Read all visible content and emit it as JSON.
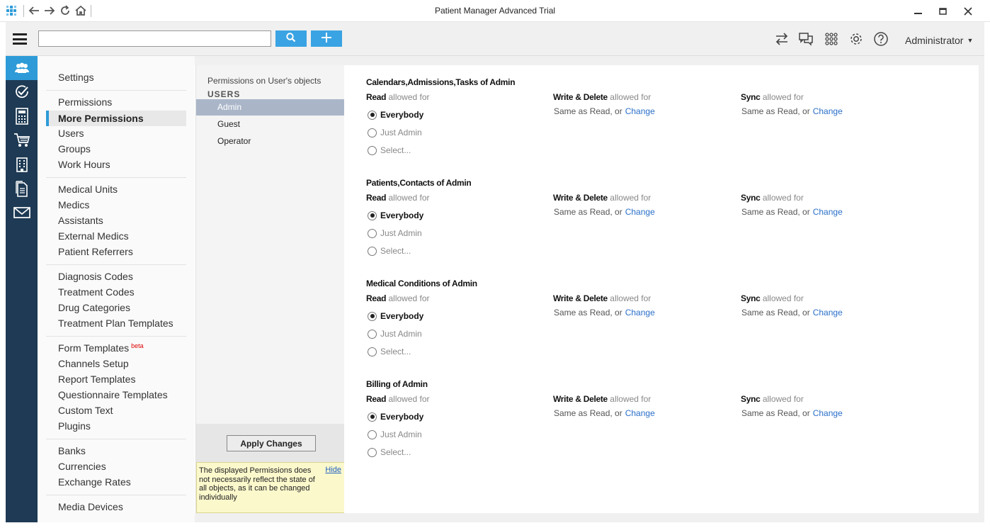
{
  "window": {
    "title": "Patient Manager Advanced Trial",
    "nav_icons": [
      "back-arrow-icon",
      "forward-arrow-icon",
      "refresh-icon",
      "home-icon"
    ],
    "controls": [
      "minimize-icon",
      "maximize-icon",
      "close-icon"
    ]
  },
  "toolbar": {
    "search_value": "",
    "search_icon": "search-icon",
    "add_icon": "plus-icon",
    "right_icons": [
      "sync-arrows-icon",
      "chat-icon",
      "apps-grid-icon",
      "gear-icon",
      "help-icon"
    ],
    "user_label": "Administrator",
    "accent": "#3aa3e3"
  },
  "rail": {
    "items": [
      "users-icon",
      "checkmark-icon",
      "calculator-icon",
      "cart-icon",
      "building-icon",
      "document-icon",
      "mail-icon"
    ],
    "active_index": 0,
    "bg": "#1e3a54",
    "active_bg": "#2e9bd8"
  },
  "settings": {
    "groups": [
      [
        "Settings"
      ],
      [
        "Permissions",
        "More Permissions",
        "Users",
        "Groups",
        "Work Hours"
      ],
      [
        "Medical Units",
        "Medics",
        "Assistants",
        "External Medics",
        "Patient Referrers"
      ],
      [
        "Diagnosis Codes",
        "Treatment Codes",
        "Drug Categories",
        "Treatment Plan Templates"
      ],
      [
        "Form Templates",
        "Channels Setup",
        "Report Templates",
        "Questionnaire Templates",
        "Custom Text",
        "Plugins"
      ],
      [
        "Banks",
        "Currencies",
        "Exchange Rates"
      ],
      [
        "Media Devices"
      ]
    ],
    "active": "More Permissions",
    "beta_label": "beta"
  },
  "users_panel": {
    "heading": "Permissions on User's objects",
    "users_label": "USERS",
    "users": [
      "Admin",
      "Guest",
      "Operator"
    ],
    "active_user": "Admin",
    "apply_label": "Apply Changes",
    "note_text": "The displayed Permissions  does not necessarily reflect the state of all objects, as it can be changed individually",
    "hide_label": "Hide"
  },
  "sections": [
    {
      "title": "Calendars,Admissions,Tasks of Admin",
      "read_label": "Read",
      "read_suffix": " allowed for",
      "write_label": "Write & Delete",
      "write_suffix": " allowed for",
      "sync_label": "Sync",
      "sync_suffix": " allowed for",
      "same_as": "Same as Read, or",
      "change": "Change",
      "options": [
        "Everybody",
        "Just Admin",
        "Select..."
      ],
      "selected": 0
    },
    {
      "title": "Patients,Contacts of Admin",
      "read_label": "Read",
      "read_suffix": " allowed for",
      "write_label": "Write & Delete",
      "write_suffix": " allowed for",
      "sync_label": "Sync",
      "sync_suffix": " allowed for",
      "same_as": "Same as Read, or",
      "change": "Change",
      "options": [
        "Everybody",
        "Just Admin",
        "Select..."
      ],
      "selected": 0
    },
    {
      "title": "Medical Conditions of Admin",
      "read_label": "Read",
      "read_suffix": " allowed for",
      "write_label": "Write & Delete",
      "write_suffix": " allowed for",
      "sync_label": "Sync",
      "sync_suffix": " allowed for",
      "same_as": "Same as Read, or",
      "change": "Change",
      "options": [
        "Everybody",
        "Just Admin",
        "Select..."
      ],
      "selected": 0
    },
    {
      "title": "Billing of Admin",
      "read_label": "Read",
      "read_suffix": " allowed for",
      "write_label": "Write & Delete",
      "write_suffix": " allowed for",
      "sync_label": "Sync",
      "sync_suffix": " allowed for",
      "same_as": "Same as Read, or",
      "change": "Change",
      "options": [
        "Everybody",
        "Just Admin",
        "Select..."
      ],
      "selected": 0
    }
  ]
}
